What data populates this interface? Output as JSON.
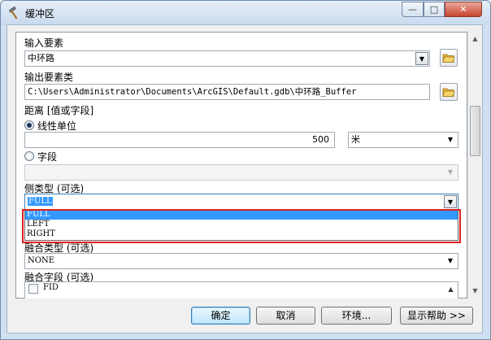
{
  "window": {
    "title": "缓冲区",
    "minimize": "—",
    "maximize": "□",
    "close": "✕",
    "title_icon": "hammer-tool-icon"
  },
  "input_features": {
    "label": "输入要素",
    "value": "中环路",
    "icon": "open-folder-icon"
  },
  "output_features": {
    "label": "输出要素类",
    "value": "C:\\Users\\Administrator\\Documents\\ArcGIS\\Default.gdb\\中环路_Buffer",
    "icon": "open-folder-icon"
  },
  "distance": {
    "label": "距离 [值或字段]",
    "linear_unit_label": "线性单位",
    "value": "500",
    "unit": "米",
    "field_label": "字段",
    "field_value": ""
  },
  "side_type": {
    "label": "侧类型 (可选)",
    "value": "FULL",
    "options": [
      "FULL",
      "LEFT",
      "RIGHT"
    ],
    "highlighted_option": "FULL",
    "annotation_color": "#e02020"
  },
  "dissolve_type": {
    "label": "融合类型 (可选)",
    "value": "NONE"
  },
  "dissolve_field": {
    "label": "融合字段 (可选)",
    "items": [
      "FID"
    ]
  },
  "buttons": {
    "ok": "确定",
    "cancel": "取消",
    "env": "环境...",
    "help": "显示帮助 >>"
  },
  "colors": {
    "selection": "#3399ff",
    "default_button_border": "#3c7fb1",
    "window_frame": "#cfe0f2"
  }
}
